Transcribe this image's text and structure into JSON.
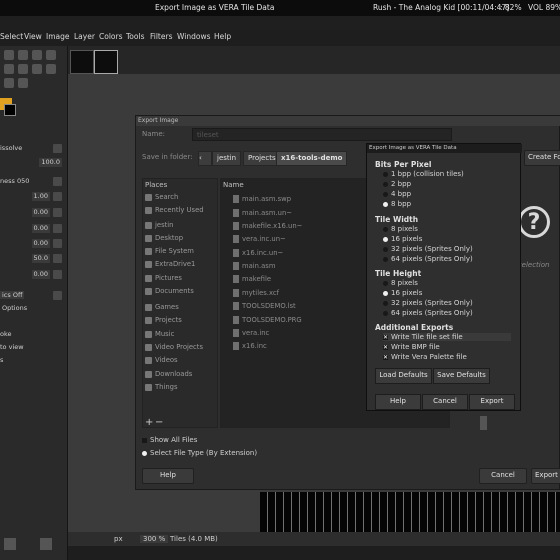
{
  "topbar": {
    "window_title": "Export Image as VERA Tile Data",
    "media": "Rush - The Analog Kid [00:11/04:47]",
    "battery": ": 82%",
    "volume": "VOL 89%"
  },
  "menu": [
    "Select",
    "View",
    "Image",
    "Layer",
    "Colors",
    "Tools",
    "Filters",
    "Windows",
    "Help"
  ],
  "tool_options": {
    "mode": "issolve",
    "opacity": "100.0",
    "brush": "ness 050",
    "rows": [
      "1.00",
      "0.00",
      "0.00",
      "0.00",
      "50.0",
      "0.00"
    ],
    "dynamics": "ics Off",
    "options_label": "Options",
    "side_texts": [
      "oke",
      "to view",
      "s"
    ]
  },
  "export_dialog": {
    "title": "Export Image",
    "name_label": "Name:",
    "name_value": "tileset",
    "save_in_label": "Save in folder:",
    "path": [
      "jestin",
      "Projects",
      "x16-tools-demo"
    ],
    "create_folder": "Create Fol",
    "places_header": "Places",
    "name_header": "Name",
    "places": [
      "Search",
      "Recently Used",
      "jestin",
      "Desktop",
      "File System",
      "ExtraDrive1",
      "Pictures",
      "Documents",
      "Games",
      "Projects",
      "Music",
      "Video Projects",
      "Videos",
      "Downloads",
      "Things"
    ],
    "files": [
      "main.asm.swp",
      "main.asm.un~",
      "makefile.x16.un~",
      "vera.inc.un~",
      "x16.inc.un~",
      "main.asm",
      "makefile",
      "mytiles.xcf",
      "TOOLSDEMO.lst",
      "TOOLSDEMO.PRG",
      "vera.inc",
      "x16.inc"
    ],
    "preview_text": "selection",
    "show_all_files": "Show All Files",
    "select_file_type": "Select File Type (By Extension)",
    "help": "Help",
    "cancel": "Cancel",
    "export": "Export"
  },
  "vera_dialog": {
    "title": "Export Image as VERA Tile Data",
    "bpp_header": "Bits Per Pixel",
    "bpp_options": [
      "1 bpp (collision tiles)",
      "2 bpp",
      "4 bpp",
      "8 bpp"
    ],
    "bpp_selected": "8 bpp",
    "width_header": "Tile Width",
    "width_options": [
      "8 pixels",
      "16 pixels",
      "32 pixels (Sprites Only)",
      "64 pixels (Sprites Only)"
    ],
    "width_selected": "16 pixels",
    "height_header": "Tile Height",
    "height_options": [
      "8 pixels",
      "16 pixels",
      "32 pixels (Sprites Only)",
      "64 pixels (Sprites Only)"
    ],
    "height_selected": "16 pixels",
    "additional_header": "Additional Exports",
    "exports": [
      "Write Tile file set file",
      "Write BMP file",
      "Write Vera Palette file"
    ],
    "load_defaults": "Load Defaults",
    "save_defaults": "Save Defaults",
    "help": "Help",
    "cancel": "Cancel",
    "export": "Export"
  },
  "statusbar": {
    "unit": "px",
    "zoom": "300 %",
    "info": "Tiles (4.0 MB)"
  },
  "colors": {
    "accent_yellow": "#e0a020",
    "fg_swatch": "#000000",
    "bg_swatch": "#ffffff"
  }
}
